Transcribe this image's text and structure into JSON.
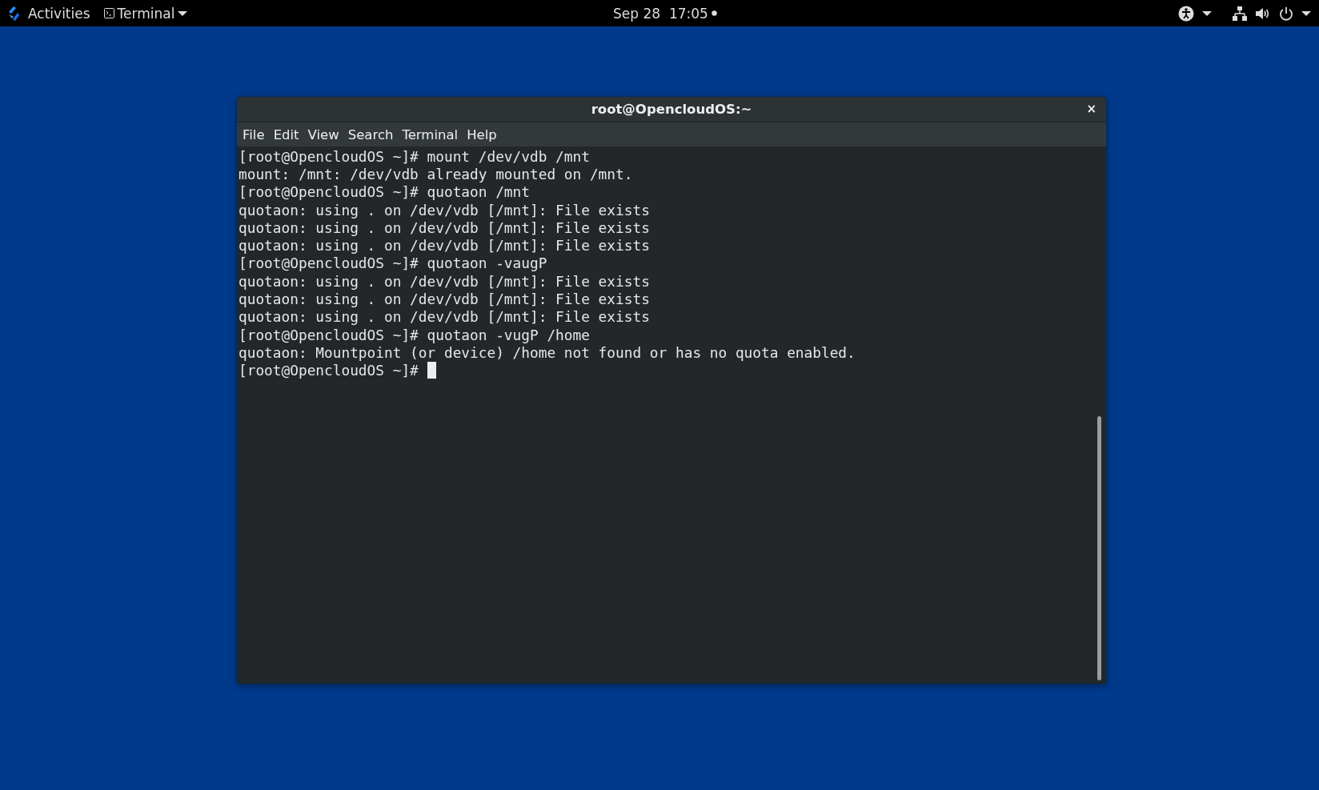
{
  "top_bar": {
    "activities": "Activities",
    "app_menu": "Terminal",
    "clock": "Sep 28  17:05"
  },
  "window": {
    "title": "root@OpencloudOS:~",
    "close": "×",
    "menu": [
      "File",
      "Edit",
      "View",
      "Search",
      "Terminal",
      "Help"
    ],
    "lines": [
      "[root@OpencloudOS ~]# mount /dev/vdb /mnt",
      "mount: /mnt: /dev/vdb already mounted on /mnt.",
      "[root@OpencloudOS ~]# quotaon /mnt",
      "quotaon: using . on /dev/vdb [/mnt]: File exists",
      "quotaon: using . on /dev/vdb [/mnt]: File exists",
      "quotaon: using . on /dev/vdb [/mnt]: File exists",
      "[root@OpencloudOS ~]# quotaon -vaugP",
      "quotaon: using . on /dev/vdb [/mnt]: File exists",
      "quotaon: using . on /dev/vdb [/mnt]: File exists",
      "quotaon: using . on /dev/vdb [/mnt]: File exists",
      "[root@OpencloudOS ~]# quotaon -vugP /home",
      "quotaon: Mountpoint (or device) /home not found or has no quota enabled.",
      "[root@OpencloudOS ~]#"
    ]
  }
}
